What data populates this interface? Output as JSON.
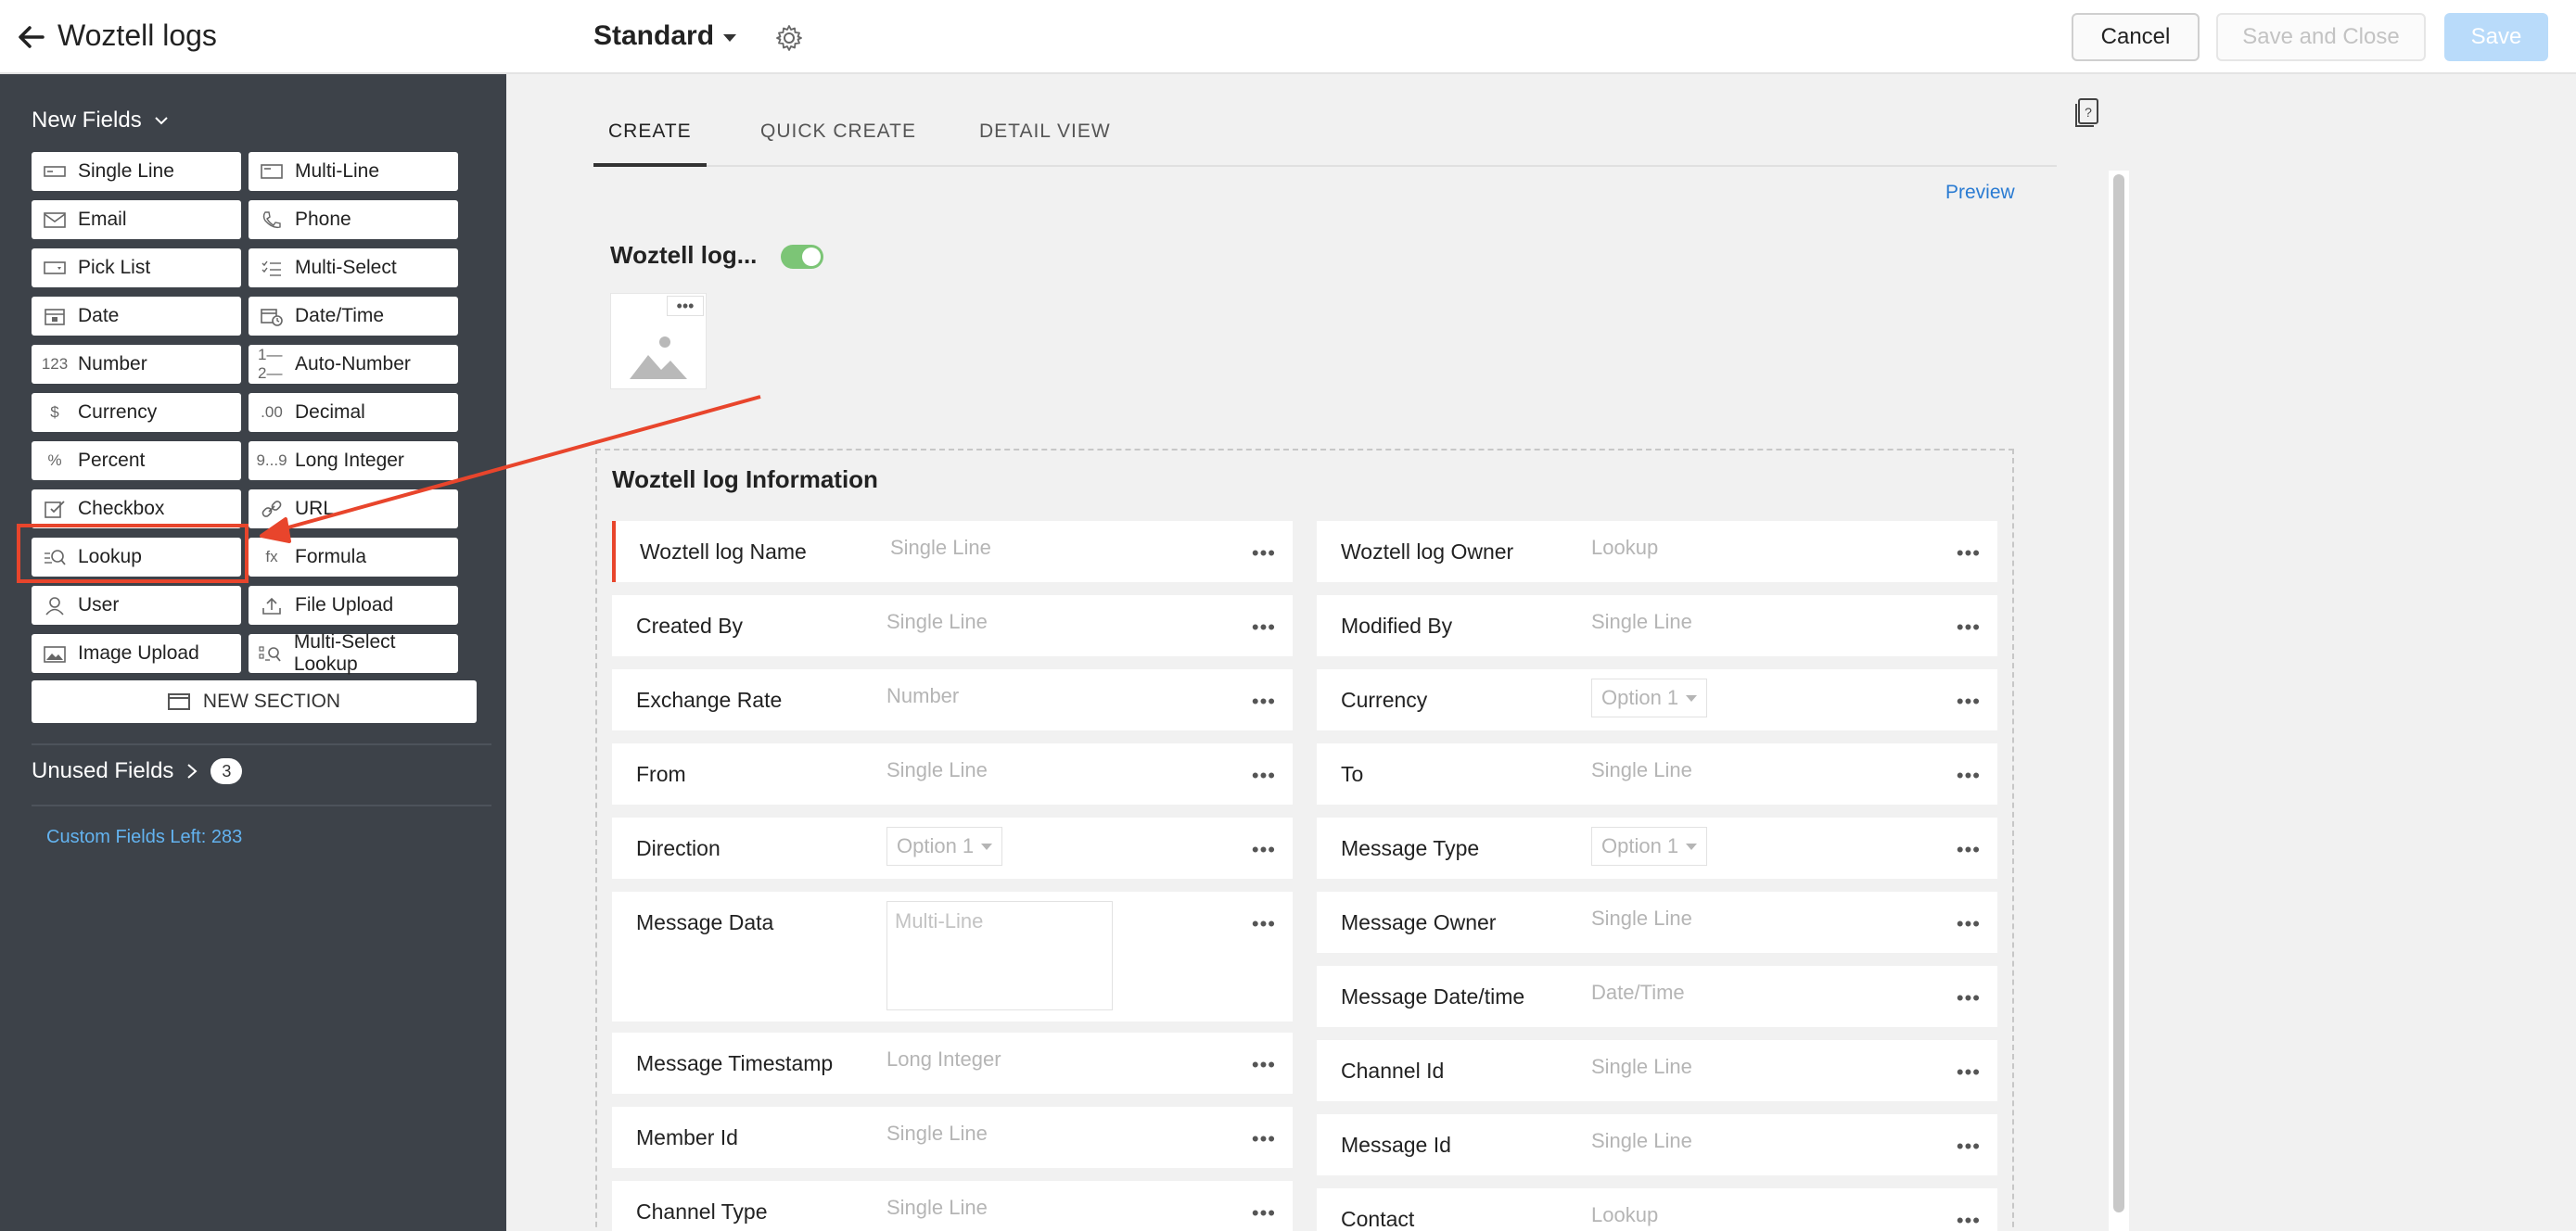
{
  "header": {
    "app_title": "Woztell logs",
    "layout_name": "Standard",
    "cancel_label": "Cancel",
    "save_close_label": "Save and Close",
    "save_label": "Save"
  },
  "sidebar": {
    "new_fields_label": "New Fields",
    "fields": [
      {
        "label": "Single Line",
        "icon": "single-line-icon"
      },
      {
        "label": "Multi-Line",
        "icon": "multi-line-icon"
      },
      {
        "label": "Email",
        "icon": "email-icon"
      },
      {
        "label": "Phone",
        "icon": "phone-icon"
      },
      {
        "label": "Pick List",
        "icon": "pick-list-icon"
      },
      {
        "label": "Multi-Select",
        "icon": "multi-select-icon"
      },
      {
        "label": "Date",
        "icon": "date-icon"
      },
      {
        "label": "Date/Time",
        "icon": "date-time-icon"
      },
      {
        "label": "Number",
        "icon": "number-icon",
        "glyph": "123"
      },
      {
        "label": "Auto-Number",
        "icon": "auto-number-icon",
        "glyph": "1—2—"
      },
      {
        "label": "Currency",
        "icon": "currency-icon",
        "glyph": "$"
      },
      {
        "label": "Decimal",
        "icon": "decimal-icon",
        "glyph": ".00"
      },
      {
        "label": "Percent",
        "icon": "percent-icon",
        "glyph": "%"
      },
      {
        "label": "Long Integer",
        "icon": "long-integer-icon",
        "glyph": "9...9"
      },
      {
        "label": "Checkbox",
        "icon": "checkbox-icon"
      },
      {
        "label": "URL",
        "icon": "url-icon"
      },
      {
        "label": "Lookup",
        "icon": "lookup-icon"
      },
      {
        "label": "Formula",
        "icon": "formula-icon",
        "glyph": "fx"
      },
      {
        "label": "User",
        "icon": "user-icon"
      },
      {
        "label": "File Upload",
        "icon": "file-upload-icon"
      },
      {
        "label": "Image Upload",
        "icon": "image-upload-icon"
      },
      {
        "label": "Multi-Select Lookup",
        "icon": "multi-select-lookup-icon"
      }
    ],
    "new_section_label": "NEW SECTION",
    "unused_fields_label": "Unused Fields",
    "unused_fields_count": "3",
    "custom_fields_left": "Custom Fields Left: 283"
  },
  "tabs": [
    {
      "label": "CREATE",
      "active": true
    },
    {
      "label": "QUICK CREATE",
      "active": false
    },
    {
      "label": "DETAIL VIEW",
      "active": false
    }
  ],
  "canvas": {
    "preview_label": "Preview",
    "record_title": "Woztell log...",
    "toggle_on": true,
    "image_menu": "•••",
    "section_title": "Woztell log Information",
    "more": "•••",
    "left_fields": [
      {
        "label": "Woztell log Name",
        "placeholder": "Single Line",
        "kind": "text",
        "mandatory": true
      },
      {
        "label": "Created By",
        "placeholder": "Single Line",
        "kind": "text"
      },
      {
        "label": "Exchange Rate",
        "placeholder": "Number",
        "kind": "text"
      },
      {
        "label": "From",
        "placeholder": "Single Line",
        "kind": "text"
      },
      {
        "label": "Direction",
        "placeholder": "Option 1",
        "kind": "select"
      },
      {
        "label": "Message Data",
        "placeholder": "Multi-Line",
        "kind": "multi"
      },
      {
        "label": "Message Timestamp",
        "placeholder": "Long Integer",
        "kind": "text"
      },
      {
        "label": "Member Id",
        "placeholder": "Single Line",
        "kind": "text"
      },
      {
        "label": "Channel Type",
        "placeholder": "Single Line",
        "kind": "text"
      }
    ],
    "right_fields": [
      {
        "label": "Woztell log Owner",
        "placeholder": "Lookup",
        "kind": "text"
      },
      {
        "label": "Modified By",
        "placeholder": "Single Line",
        "kind": "text"
      },
      {
        "label": "Currency",
        "placeholder": "Option 1",
        "kind": "select"
      },
      {
        "label": "To",
        "placeholder": "Single Line",
        "kind": "text"
      },
      {
        "label": "Message Type",
        "placeholder": "Option 1",
        "kind": "select"
      },
      {
        "label": "Message Owner",
        "placeholder": "Single Line",
        "kind": "text"
      },
      {
        "label": "Message Date/time",
        "placeholder": "Date/Time",
        "kind": "text"
      },
      {
        "label": "Channel Id",
        "placeholder": "Single Line",
        "kind": "text"
      },
      {
        "label": "Message Id",
        "placeholder": "Single Line",
        "kind": "text"
      },
      {
        "label": "Contact",
        "placeholder": "Lookup",
        "kind": "text"
      }
    ]
  },
  "colors": {
    "sidebar_bg": "#3d4249",
    "accent_red": "#e8452c",
    "link_blue": "#2a7bd2",
    "toggle_green": "#7cc576",
    "save_disabled": "#b9dbfa"
  }
}
